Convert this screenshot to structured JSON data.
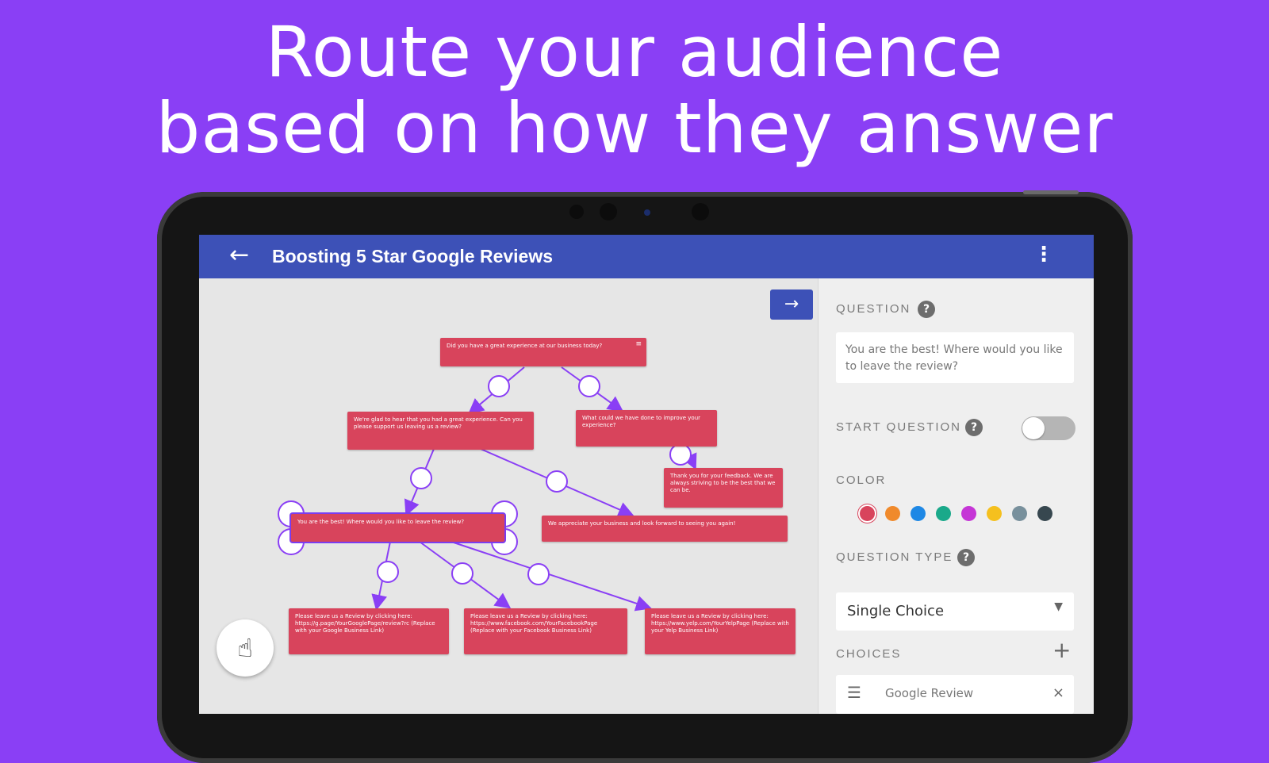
{
  "headline": {
    "line1": "Route your audience",
    "line2": "based on how they answer"
  },
  "appbar": {
    "back_icon": "←",
    "title": "Boosting 5 Star Google Reviews",
    "more_icon": "⋮"
  },
  "canvas": {
    "next_icon": "→",
    "fab_icon": "☝",
    "nodes": [
      "Did you have a great experience at our business today?",
      "We're glad to hear that you had a great experience. Can you please support us leaving us a review?",
      "What could we have done to improve your experience?",
      "Thank you for your feedback. We are always striving to be the best that we can be.",
      "You are the best! Where would you like to leave the review?",
      "We appreciate your business and look forward to seeing you again!",
      "Please leave us a Review by clicking here: https://g.page/YourGooglePage/review?rc (Replace with your Google Business Link)",
      "Please leave us a Review by clicking here: https://www.facebook.com/YourFacebookPage (Replace with your Facebook Business Link)",
      "Please leave us a Review by clicking here: https://www.yelp.com/YourYelpPage (Replace with your Yelp Business Link)"
    ]
  },
  "panel": {
    "question_label": "QUESTION",
    "question_text": "You are the best! Where would you like to leave the review?",
    "start_label": "START QUESTION",
    "start_enabled": false,
    "color_label": "COLOR",
    "colors": [
      "#d8445c",
      "#f08a2c",
      "#1e88e5",
      "#1aa98a",
      "#c535d6",
      "#f5c01e",
      "#78909c",
      "#37474f"
    ],
    "selected_color": "#d8445c",
    "type_label": "QUESTION TYPE",
    "type_value": "Single Choice",
    "choices_label": "CHOICES",
    "choices": [
      "Google Review"
    ],
    "help_icon": "?",
    "plus_icon": "+",
    "caret_icon": "▼",
    "drag_icon": "☰",
    "remove_icon": "×"
  }
}
